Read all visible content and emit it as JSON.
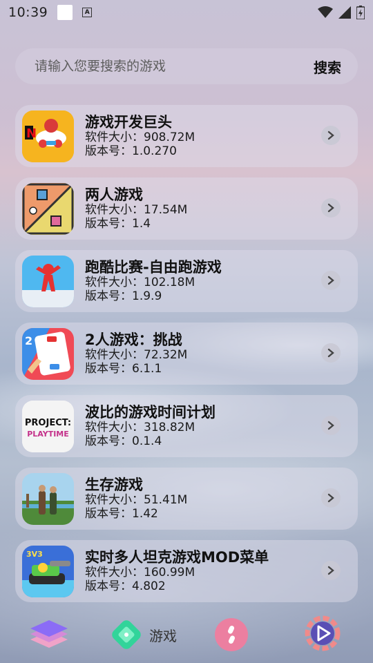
{
  "status_bar": {
    "time": "10:39",
    "notification_letter": "A"
  },
  "search": {
    "placeholder": "请输入您要搜索的游戏",
    "button_label": "搜索"
  },
  "games": [
    {
      "title": "游戏开发巨头",
      "size": "软件大小：908.72M",
      "version": "版本号：1.0.270",
      "icon": "game-dev-tycoon-icon"
    },
    {
      "title": "两人游戏",
      "size": "软件大小：17.54M",
      "version": "版本号：1.4",
      "icon": "two-player-games-icon"
    },
    {
      "title": "跑酷比赛-自由跑游戏",
      "size": "软件大小：102.18M",
      "version": "版本号：1.9.9",
      "icon": "parkour-race-icon"
    },
    {
      "title": "2人游戏：挑战",
      "size": "软件大小：72.32M",
      "version": "版本号：6.1.1",
      "icon": "two-player-challenge-icon"
    },
    {
      "title": "波比的游戏时间计划",
      "size": "软件大小：318.82M",
      "version": "版本号：0.1.4",
      "icon": "project-playtime-icon",
      "icon_text": [
        "PROJECT:",
        "PLAYTIME"
      ]
    },
    {
      "title": "生存游戏",
      "size": "软件大小：51.41M",
      "version": "版本号：1.42",
      "icon": "survival-game-icon"
    },
    {
      "title": "实时多人坦克游戏MOD菜单",
      "size": "软件大小：160.99M",
      "version": "版本号：4.802",
      "icon": "tank-game-icon",
      "icon_text": [
        "3V3"
      ]
    }
  ],
  "bottom_nav": {
    "items": [
      {
        "icon": "layers-icon"
      },
      {
        "icon": "puzzle-icon",
        "label": "游戏"
      },
      {
        "icon": "link-icon"
      },
      {
        "icon": "play-gear-icon"
      }
    ]
  },
  "colors": {
    "netflix_red": "#e50914",
    "nav_pink": "#e86a8f",
    "nav_green": "#32d49a",
    "nav_purple": "#8b6cf6"
  }
}
